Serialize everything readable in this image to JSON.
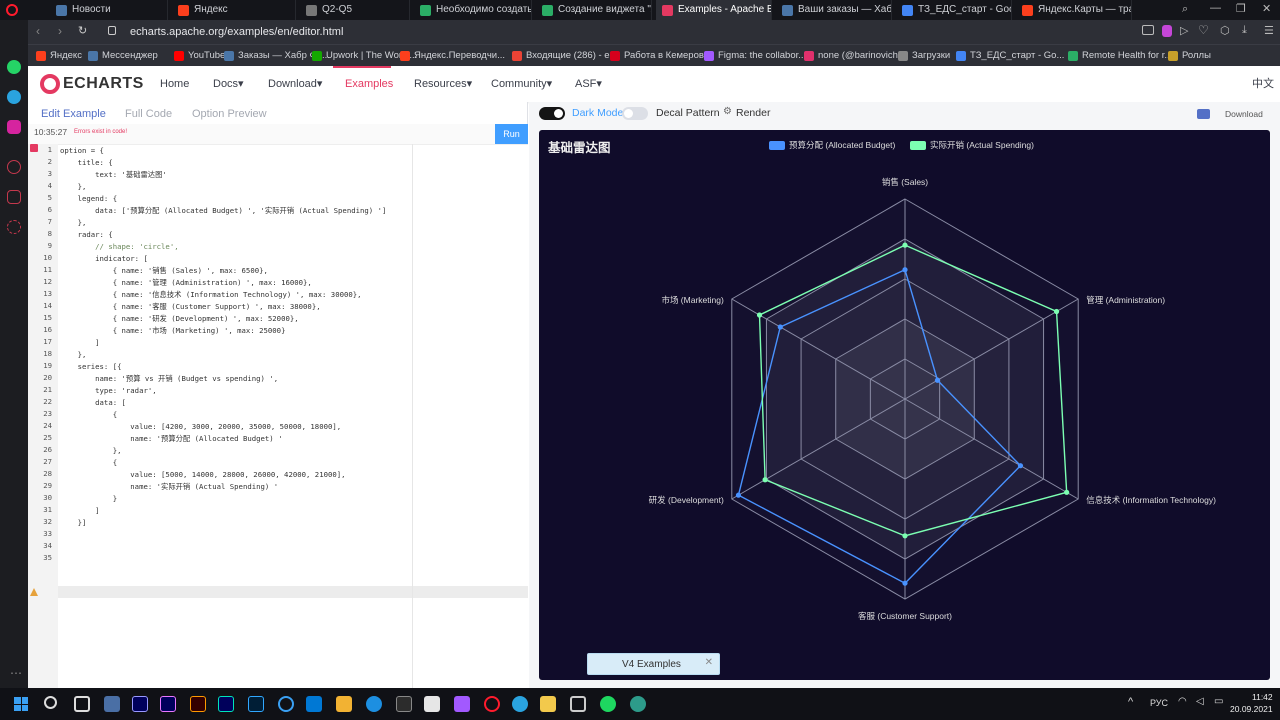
{
  "browser": {
    "tabs": [
      {
        "label": "Новости",
        "color": "#4a76a8"
      },
      {
        "label": "Яндекс",
        "color": "#fc3f1d"
      },
      {
        "label": "Q2-Q5",
        "color": "#777"
      },
      {
        "label": "Необходимо создать н",
        "color": "#2bae66"
      },
      {
        "label": "Создание виджета \"Ли",
        "color": "#2bae66"
      },
      {
        "label": "Examples - Apache ECh",
        "color": "#e43961"
      },
      {
        "label": "Ваши заказы — Хабр Ф",
        "color": "#4a76a8"
      },
      {
        "label": "ТЗ_ЕДС_старт - Google",
        "color": "#4285f4"
      },
      {
        "label": "Яндекс.Карты — транс",
        "color": "#fc3f1d"
      }
    ],
    "url": "echarts.apache.org/examples/en/editor.html",
    "bookmarks": [
      {
        "label": "Яндекс",
        "color": "#fc3f1d"
      },
      {
        "label": "Мессенджер",
        "color": "#4a76a8"
      },
      {
        "label": "YouTube",
        "color": "#ff0000"
      },
      {
        "label": "Заказы — Хабр Фр...",
        "color": "#4a76a8"
      },
      {
        "label": "Upwork | The World...",
        "color": "#14a800"
      },
      {
        "label": "Яндекс.Переводчи...",
        "color": "#fc3f1d"
      },
      {
        "label": "Входящие (286) - е...",
        "color": "#ea4335"
      },
      {
        "label": "Работа в Кемеров...",
        "color": "#d6001c"
      },
      {
        "label": "Figma: the collabor...",
        "color": "#a259ff"
      },
      {
        "label": "none (@barinovich...",
        "color": "#e1306c"
      },
      {
        "label": "Загрузки",
        "color": "#888"
      },
      {
        "label": "ТЗ_ЕДС_старт - Go...",
        "color": "#4285f4"
      },
      {
        "label": "Remote Health for r...",
        "color": "#2bae66"
      },
      {
        "label": "Роллы",
        "color": "#c8a02a"
      }
    ]
  },
  "nav": {
    "logo": "ECHARTS",
    "items": [
      "Home",
      "Docs▾",
      "Download▾",
      "Examples",
      "Resources▾",
      "Community▾",
      "ASF▾"
    ],
    "lang": "中文"
  },
  "editor": {
    "tabs": [
      "Edit Example",
      "Full Code",
      "Option Preview"
    ],
    "time": "10:35:27",
    "error": "Errors exist in code!",
    "run": "Run",
    "lines": [
      "option = {",
      "    title: {",
      "        text: '基础雷达图'",
      "    },",
      "    legend: {",
      "        data: ['预算分配 (Allocated Budget) ', '实际开销 (Actual Spending) ']",
      "    },",
      "    radar: {",
      "        // shape: 'circle',",
      "        indicator: [",
      "            { name: '销售 (Sales) ', max: 6500},",
      "            { name: '管理 (Administration) ', max: 16000},",
      "            { name: '信息技术 (Information Technology) ', max: 30000},",
      "            { name: '客服 (Customer Support) ', max: 38000},",
      "            { name: '研发 (Development) ', max: 52000},",
      "            { name: '市场 (Marketing) ', max: 25000}",
      "        ]",
      "    },",
      "    series: [{",
      "        name: '预算 vs 开销 (Budget vs spending) ',",
      "        type: 'radar',",
      "        data: [",
      "            {",
      "                value: [4200, 3000, 20000, 35000, 50000, 18000],",
      "                name: '预算分配 (Allocated Budget) '",
      "            },",
      "            {",
      "                value: [5000, 14000, 28000, 26000, 42000, 21000],",
      "                name: '实际开销 (Actual Spending) '",
      "            }",
      "        ]",
      "    }]",
      "",
      "",
      ""
    ]
  },
  "preview": {
    "dark_mode": "Dark Mode",
    "decal": "Decal Pattern",
    "render": "Render",
    "download": "Download",
    "v4": "V4 Examples"
  },
  "chart_data": {
    "type": "radar",
    "title": "基础雷达图",
    "indicators": [
      {
        "name": "销售 (Sales)",
        "max": 6500
      },
      {
        "name": "管理 (Administration)",
        "max": 16000
      },
      {
        "name": "信息技术 (Information Technology)",
        "max": 30000
      },
      {
        "name": "客服 (Customer Support)",
        "max": 38000
      },
      {
        "name": "研发 (Development)",
        "max": 52000
      },
      {
        "name": "市场 (Marketing)",
        "max": 25000
      }
    ],
    "series": [
      {
        "name": "预算分配 (Allocated Budget)",
        "color": "#4992ff",
        "values": [
          4200,
          3000,
          20000,
          35000,
          50000,
          18000
        ]
      },
      {
        "name": "实际开销 (Actual Spending)",
        "color": "#7cffb2",
        "values": [
          5000,
          14000,
          28000,
          26000,
          42000,
          21000
        ]
      }
    ],
    "legend_position": "top-center"
  },
  "taskbar": {
    "lang": "РУС",
    "time": "11:42",
    "date": "20.09.2021"
  }
}
